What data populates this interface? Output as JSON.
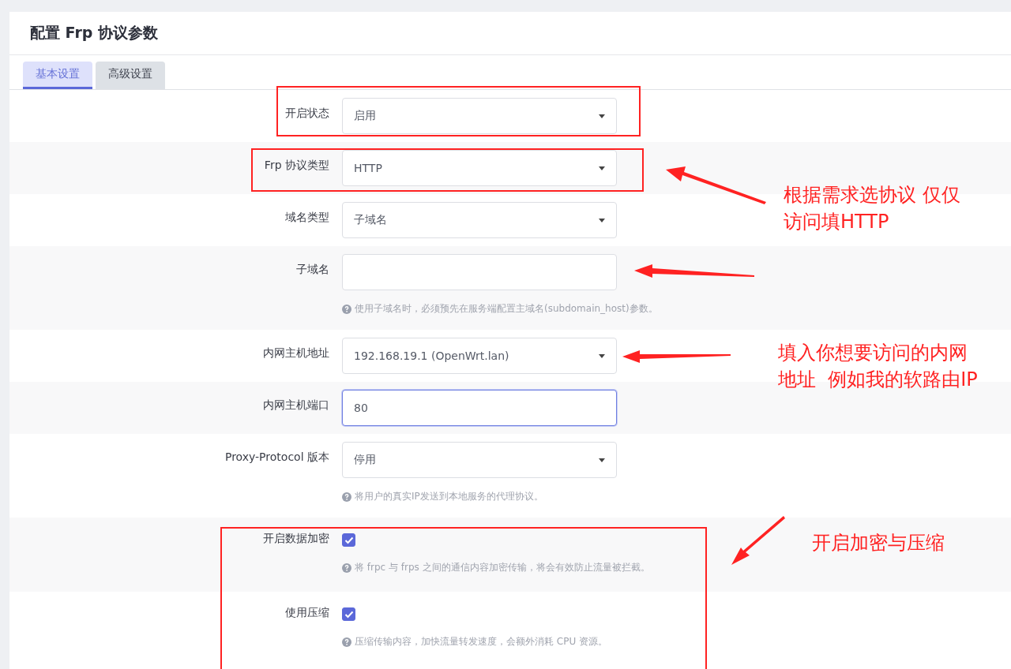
{
  "page": {
    "title": "配置 Frp 协议参数"
  },
  "tabs": [
    {
      "label": "基本设置",
      "selected": true
    },
    {
      "label": "高级设置",
      "selected": false
    }
  ],
  "fields": [
    {
      "kind": "select",
      "label": "开启状态",
      "value": "启用"
    },
    {
      "kind": "select",
      "label": "Frp 协议类型",
      "value": "HTTP"
    },
    {
      "kind": "select",
      "label": "域名类型",
      "value": "子域名"
    },
    {
      "kind": "text",
      "label": "子域名",
      "focused": false,
      "hint": "使用子域名时，必须预先在服务端配置主域名(subdomain_host)参数。"
    },
    {
      "kind": "select",
      "label": "内网主机地址",
      "value": "192.168.19.1 (OpenWrt.lan)"
    },
    {
      "kind": "text",
      "label": "内网主机端口",
      "value": "80",
      "focused": true
    },
    {
      "kind": "select",
      "label": "Proxy-Protocol 版本",
      "value": "停用",
      "hint": "将用户的真实IP发送到本地服务的代理协议。"
    },
    {
      "kind": "checkbox",
      "label": "开启数据加密",
      "checked": true,
      "hint": "将 frpc 与 frps 之间的通信内容加密传输，将会有效防止流量被拦截。"
    },
    {
      "kind": "checkbox",
      "label": "使用压缩",
      "checked": true,
      "hint": "压缩传输内容，加快流量转发速度，会额外消耗 CPU 资源。"
    }
  ],
  "annotations": [
    {
      "lines": [
        "根据需求选协议 仅仅",
        "访问填HTTP"
      ]
    },
    {
      "lines": [
        "填入你想要访问的内网",
        "地址  例如我的软路由IP"
      ]
    },
    {
      "lines": [
        "开启加密与压缩"
      ]
    }
  ]
}
